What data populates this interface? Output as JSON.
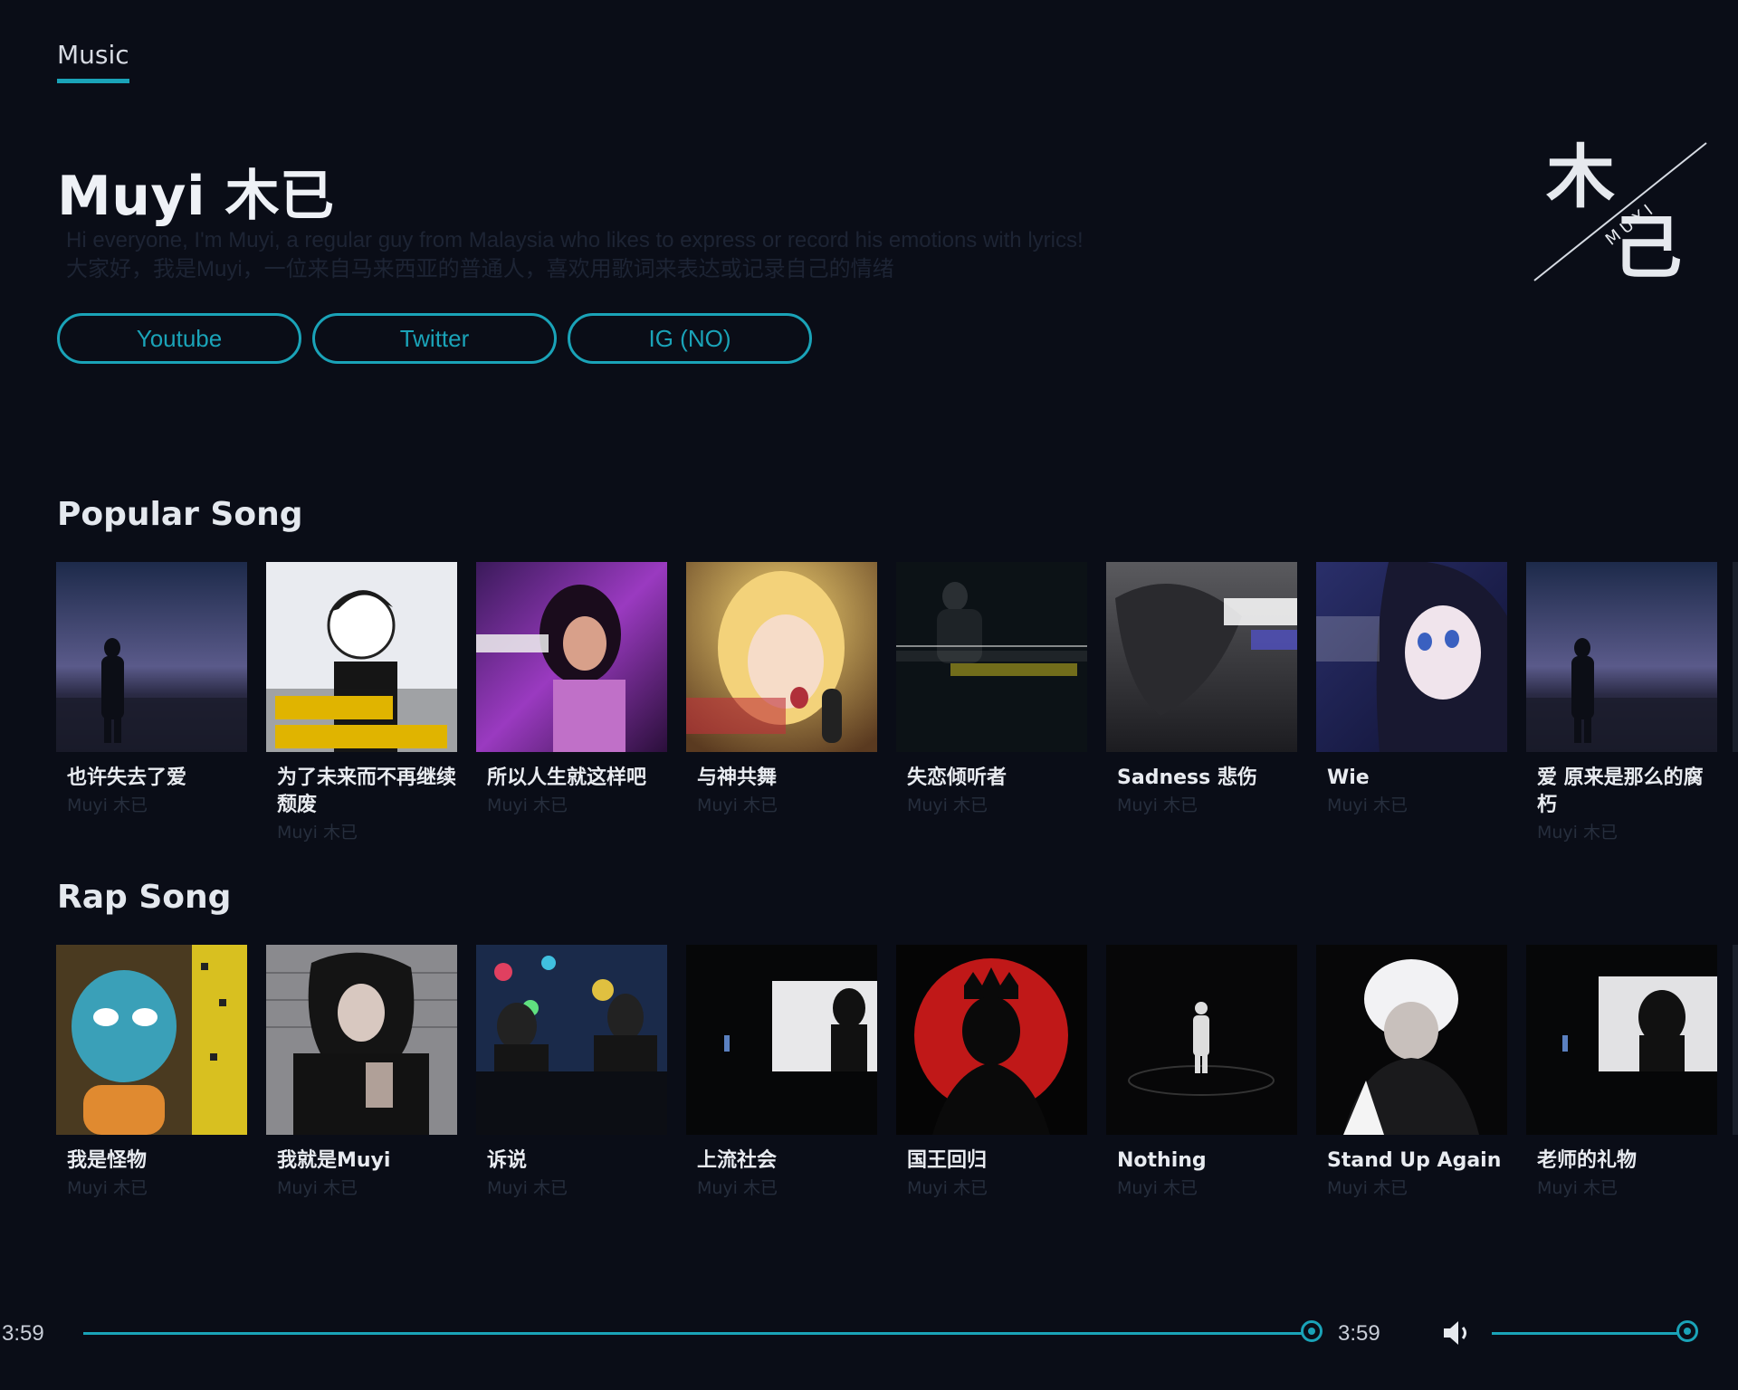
{
  "nav": {
    "tabs": [
      {
        "label": "Music"
      }
    ]
  },
  "artist": {
    "name": "Muyi 木已",
    "bio_en": "Hi everyone, I'm Muyi, a regular guy from Malaysia who likes to express or record his emotions with lyrics!",
    "bio_zh": "大家好，我是Muyi，一位来自马来西亚的普通人，喜欢用歌词来表达或记录自己的情绪",
    "logo": {
      "glyph_top": "木",
      "glyph_bottom": "己",
      "text": "MUYI"
    }
  },
  "links": [
    {
      "label": "Youtube"
    },
    {
      "label": "Twitter"
    },
    {
      "label": "IG (NO)"
    }
  ],
  "sections": {
    "popular": {
      "title": "Popular Song",
      "songs": [
        {
          "title": "也许失去了爱",
          "artist": "Muyi 木已"
        },
        {
          "title": "为了未来而不再继续颓废",
          "artist": "Muyi 木已"
        },
        {
          "title": "所以人生就这样吧",
          "artist": "Muyi 木已"
        },
        {
          "title": "与神共舞",
          "artist": "Muyi 木已"
        },
        {
          "title": "失恋倾听者",
          "artist": "Muyi 木已"
        },
        {
          "title": "Sadness 悲伤",
          "artist": "Muyi 木已"
        },
        {
          "title": "Wie",
          "artist": "Muyi 木已"
        },
        {
          "title": "爱 原来是那么的腐朽",
          "artist": "Muyi 木已"
        }
      ]
    },
    "rap": {
      "title": "Rap Song",
      "songs": [
        {
          "title": "我是怪物",
          "artist": "Muyi 木已"
        },
        {
          "title": "我就是Muyi",
          "artist": "Muyi 木已"
        },
        {
          "title": "诉说",
          "artist": "Muyi 木已"
        },
        {
          "title": "上流社会",
          "artist": "Muyi 木已"
        },
        {
          "title": "国王回归",
          "artist": "Muyi 木已"
        },
        {
          "title": "Nothing",
          "artist": "Muyi 木已"
        },
        {
          "title": "Stand Up Again",
          "artist": "Muyi 木已"
        },
        {
          "title": "老师的礼物",
          "artist": "Muyi 木已"
        }
      ]
    }
  },
  "player": {
    "current_time": "3:59",
    "duration": "3:59",
    "progress": 1.0,
    "volume": 1.0,
    "volume_icon": "speaker-icon"
  },
  "colors": {
    "accent": "#1aa3b8",
    "background": "#0a0d17",
    "muted_text": "#262e3d"
  }
}
